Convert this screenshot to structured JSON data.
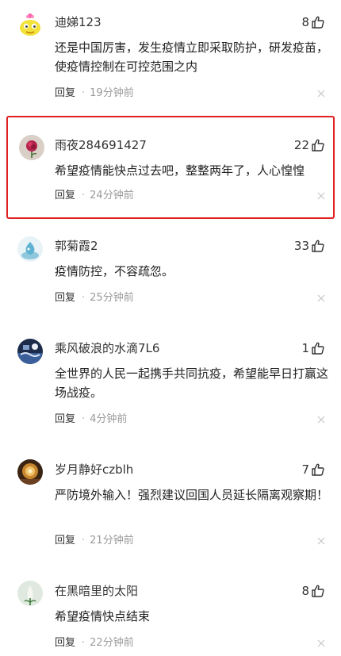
{
  "icons": {
    "like": "thumbs-up-icon",
    "close": "close-icon"
  },
  "colors": {
    "highlight_border": "#e02020",
    "meta_gray": "#9a9a9a"
  },
  "comments": [
    {
      "user": "迪娣123",
      "likes": "8",
      "text": "还是中国厉害，发生疫情立即采取防护，研发疫苗，使疫情控制在可控范围之内",
      "reply": "回复",
      "separator": "·",
      "time": "19分钟前"
    },
    {
      "user": "雨夜284691427",
      "likes": "22",
      "text": "希望疫情能快点过去吧，整整两年了，人心惶惶",
      "reply": "回复",
      "separator": "·",
      "time": "24分钟前"
    },
    {
      "user": "郭菊霞2",
      "likes": "33",
      "text": "疫情防控，不容疏忽。",
      "reply": "回复",
      "separator": "·",
      "time": "25分钟前"
    },
    {
      "user": "乘风破浪的水滴7L6",
      "likes": "1",
      "text": "全世界的人民一起携手共同抗疫，希望能早日打赢这场战疫。",
      "reply": "回复",
      "separator": "·",
      "time": "4分钟前"
    },
    {
      "user": "岁月静好czblh",
      "likes": "7",
      "text": "严防境外输入！强烈建议回国人员延长隔离观察期！",
      "reply": "回复",
      "separator": "·",
      "time": "21分钟前"
    },
    {
      "user": "在黑暗里的太阳",
      "likes": "8",
      "text": "希望疫情快点结束",
      "reply": "回复",
      "separator": "·",
      "time": "22分钟前"
    }
  ]
}
